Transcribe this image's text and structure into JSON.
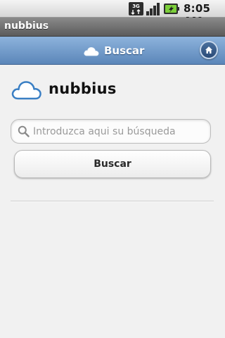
{
  "status_bar": {
    "network_label": "3G",
    "time": "8:05 AM",
    "icons": [
      "3g-icon",
      "signal-icon",
      "battery-charging-icon"
    ]
  },
  "app_title": "nubbius",
  "header": {
    "title": "Buscar",
    "icon": "cloud-icon",
    "home_icon": "home-icon"
  },
  "brand": {
    "name": "nubbius",
    "logo_icon": "cloud-logo-icon"
  },
  "search": {
    "placeholder": "Introduzca aqui su búsqueda",
    "value": "",
    "icon": "search-icon"
  },
  "search_button": {
    "label": "Buscar"
  },
  "colors": {
    "header_top": "#8db3dc",
    "header_bottom": "#5b86b9",
    "logo_blue": "#3a7fc4",
    "background": "#f1f1f1"
  }
}
